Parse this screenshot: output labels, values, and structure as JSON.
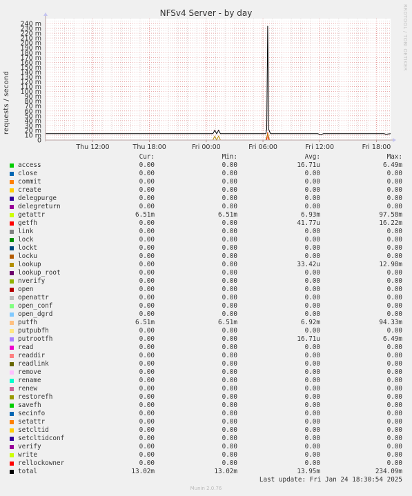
{
  "chart_data": {
    "type": "line",
    "title": "NFSv4 Server - by day",
    "ylabel": "requests / second",
    "ylim": [
      0,
      250
    ],
    "y_ticks": [
      0,
      10,
      20,
      30,
      40,
      50,
      60,
      70,
      80,
      90,
      100,
      110,
      120,
      130,
      140,
      150,
      160,
      170,
      180,
      190,
      200,
      210,
      220,
      230,
      240
    ],
    "y_tick_labels": [
      "0",
      "10 m",
      "20 m",
      "30 m",
      "40 m",
      "50 m",
      "60 m",
      "70 m",
      "80 m",
      "90 m",
      "100 m",
      "110 m",
      "120 m",
      "130 m",
      "140 m",
      "150 m",
      "160 m",
      "170 m",
      "180 m",
      "190 m",
      "200 m",
      "210 m",
      "220 m",
      "230 m",
      "240 m"
    ],
    "x_tick_labels": [
      "Thu 12:00",
      "Thu 18:00",
      "Fri 00:00",
      "Fri 06:00",
      "Fri 12:00",
      "Fri 18:00"
    ],
    "x_tick_hours": [
      5,
      11,
      17,
      23,
      29,
      35
    ],
    "x_range_hours": [
      0,
      36.5
    ],
    "grid": true,
    "series": [
      {
        "name": "total",
        "color": "#000000",
        "points": [
          [
            0,
            13
          ],
          [
            17.7,
            13
          ],
          [
            17.9,
            20
          ],
          [
            18.1,
            13
          ],
          [
            18.3,
            20
          ],
          [
            18.5,
            13
          ],
          [
            23.3,
            13
          ],
          [
            23.4,
            22
          ],
          [
            23.5,
            235
          ],
          [
            23.6,
            22
          ],
          [
            23.8,
            13
          ],
          [
            28.8,
            13
          ],
          [
            29.1,
            11
          ],
          [
            29.4,
            13
          ],
          [
            35.8,
            13
          ],
          [
            36.0,
            12
          ],
          [
            36.5,
            13
          ]
        ]
      },
      {
        "name": "lookup",
        "color": "#b88a00",
        "points": [
          [
            0,
            0
          ],
          [
            17.7,
            0
          ],
          [
            17.9,
            8
          ],
          [
            18.1,
            0
          ],
          [
            18.3,
            8
          ],
          [
            18.5,
            0
          ],
          [
            23.3,
            0
          ],
          [
            23.5,
            13
          ],
          [
            23.7,
            0
          ],
          [
            36.5,
            0
          ]
        ]
      },
      {
        "name": "getfh",
        "color": "#ff0000",
        "points": [
          [
            0,
            0
          ],
          [
            23.4,
            0
          ],
          [
            23.5,
            16
          ],
          [
            23.6,
            0
          ],
          [
            36.5,
            0
          ]
        ]
      }
    ]
  },
  "legend": {
    "headers": {
      "cur": "Cur:",
      "min": "Min:",
      "avg": "Avg:",
      "max": "Max:"
    },
    "rows": [
      {
        "name": "access",
        "color": "#00cc00",
        "cur": "0.00",
        "min": "0.00",
        "avg": "16.71u",
        "max": "6.49m"
      },
      {
        "name": "close",
        "color": "#0066b3",
        "cur": "0.00",
        "min": "0.00",
        "avg": "0.00",
        "max": "0.00"
      },
      {
        "name": "commit",
        "color": "#ff8000",
        "cur": "0.00",
        "min": "0.00",
        "avg": "0.00",
        "max": "0.00"
      },
      {
        "name": "create",
        "color": "#ffcc00",
        "cur": "0.00",
        "min": "0.00",
        "avg": "0.00",
        "max": "0.00"
      },
      {
        "name": "delegpurge",
        "color": "#330099",
        "cur": "0.00",
        "min": "0.00",
        "avg": "0.00",
        "max": "0.00"
      },
      {
        "name": "delegreturn",
        "color": "#990099",
        "cur": "0.00",
        "min": "0.00",
        "avg": "0.00",
        "max": "0.00"
      },
      {
        "name": "getattr",
        "color": "#ccff00",
        "cur": "6.51m",
        "min": "6.51m",
        "avg": "6.93m",
        "max": "97.58m"
      },
      {
        "name": "getfh",
        "color": "#ff0000",
        "cur": "0.00",
        "min": "0.00",
        "avg": "41.77u",
        "max": "16.22m"
      },
      {
        "name": "link",
        "color": "#808080",
        "cur": "0.00",
        "min": "0.00",
        "avg": "0.00",
        "max": "0.00"
      },
      {
        "name": "lock",
        "color": "#008f00",
        "cur": "0.00",
        "min": "0.00",
        "avg": "0.00",
        "max": "0.00"
      },
      {
        "name": "lockt",
        "color": "#00487d",
        "cur": "0.00",
        "min": "0.00",
        "avg": "0.00",
        "max": "0.00"
      },
      {
        "name": "locku",
        "color": "#b35a00",
        "cur": "0.00",
        "min": "0.00",
        "avg": "0.00",
        "max": "0.00"
      },
      {
        "name": "lookup",
        "color": "#b38f00",
        "cur": "0.00",
        "min": "0.00",
        "avg": "33.42u",
        "max": "12.98m"
      },
      {
        "name": "lookup_root",
        "color": "#6b006b",
        "cur": "0.00",
        "min": "0.00",
        "avg": "0.00",
        "max": "0.00"
      },
      {
        "name": "nverify",
        "color": "#8fb300",
        "cur": "0.00",
        "min": "0.00",
        "avg": "0.00",
        "max": "0.00"
      },
      {
        "name": "open",
        "color": "#b30000",
        "cur": "0.00",
        "min": "0.00",
        "avg": "0.00",
        "max": "0.00"
      },
      {
        "name": "openattr",
        "color": "#bebebe",
        "cur": "0.00",
        "min": "0.00",
        "avg": "0.00",
        "max": "0.00"
      },
      {
        "name": "open_conf",
        "color": "#80ff80",
        "cur": "0.00",
        "min": "0.00",
        "avg": "0.00",
        "max": "0.00"
      },
      {
        "name": "open_dgrd",
        "color": "#80c9ff",
        "cur": "0.00",
        "min": "0.00",
        "avg": "0.00",
        "max": "0.00"
      },
      {
        "name": "putfh",
        "color": "#ffc080",
        "cur": "6.51m",
        "min": "6.51m",
        "avg": "6.92m",
        "max": "94.33m"
      },
      {
        "name": "putpubfh",
        "color": "#ffe680",
        "cur": "0.00",
        "min": "0.00",
        "avg": "0.00",
        "max": "0.00"
      },
      {
        "name": "putrootfh",
        "color": "#aa80ff",
        "cur": "0.00",
        "min": "0.00",
        "avg": "16.71u",
        "max": "6.49m"
      },
      {
        "name": "read",
        "color": "#ee00cc",
        "cur": "0.00",
        "min": "0.00",
        "avg": "0.00",
        "max": "0.00"
      },
      {
        "name": "readdir",
        "color": "#ff8080",
        "cur": "0.00",
        "min": "0.00",
        "avg": "0.00",
        "max": "0.00"
      },
      {
        "name": "readlink",
        "color": "#666600",
        "cur": "0.00",
        "min": "0.00",
        "avg": "0.00",
        "max": "0.00"
      },
      {
        "name": "remove",
        "color": "#ffbfff",
        "cur": "0.00",
        "min": "0.00",
        "avg": "0.00",
        "max": "0.00"
      },
      {
        "name": "rename",
        "color": "#00ffcc",
        "cur": "0.00",
        "min": "0.00",
        "avg": "0.00",
        "max": "0.00"
      },
      {
        "name": "renew",
        "color": "#cc6699",
        "cur": "0.00",
        "min": "0.00",
        "avg": "0.00",
        "max": "0.00"
      },
      {
        "name": "restorefh",
        "color": "#999900",
        "cur": "0.00",
        "min": "0.00",
        "avg": "0.00",
        "max": "0.00"
      },
      {
        "name": "savefh",
        "color": "#00cc00",
        "cur": "0.00",
        "min": "0.00",
        "avg": "0.00",
        "max": "0.00"
      },
      {
        "name": "secinfo",
        "color": "#0066b3",
        "cur": "0.00",
        "min": "0.00",
        "avg": "0.00",
        "max": "0.00"
      },
      {
        "name": "setattr",
        "color": "#ff8000",
        "cur": "0.00",
        "min": "0.00",
        "avg": "0.00",
        "max": "0.00"
      },
      {
        "name": "setcltid",
        "color": "#ffcc00",
        "cur": "0.00",
        "min": "0.00",
        "avg": "0.00",
        "max": "0.00"
      },
      {
        "name": "setcltidconf",
        "color": "#330099",
        "cur": "0.00",
        "min": "0.00",
        "avg": "0.00",
        "max": "0.00"
      },
      {
        "name": "verify",
        "color": "#990099",
        "cur": "0.00",
        "min": "0.00",
        "avg": "0.00",
        "max": "0.00"
      },
      {
        "name": "write",
        "color": "#ccff00",
        "cur": "0.00",
        "min": "0.00",
        "avg": "0.00",
        "max": "0.00"
      },
      {
        "name": "rellockowner",
        "color": "#ff0000",
        "cur": "0.00",
        "min": "0.00",
        "avg": "0.00",
        "max": "0.00"
      },
      {
        "name": "total",
        "color": "#000000",
        "cur": "13.02m",
        "min": "13.02m",
        "avg": "13.95m",
        "max": "234.09m"
      }
    ]
  },
  "last_update": "Last update: Fri Jan 24 18:30:54 2025",
  "watermark": "RRDTOOL / TOBI OETIKER",
  "footer": "Munin 2.0.76"
}
